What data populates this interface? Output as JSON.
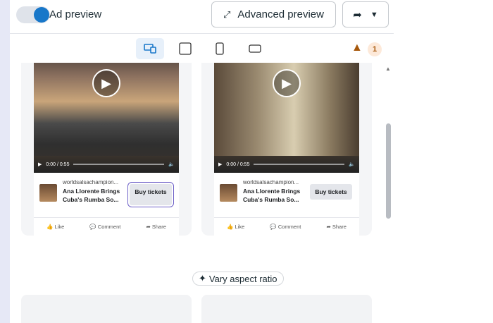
{
  "toggle": {
    "label": "Ad preview",
    "on": true
  },
  "toolbar": {
    "advanced_label": "Advanced preview"
  },
  "warnings": {
    "count": "1"
  },
  "cards": [
    {
      "time": "0:00 / 0:55",
      "domain": "worldsalsachampion...",
      "title": "Ana Llorente Brings Cuba's Rumba So...",
      "cta": "Buy tickets",
      "like": "Like",
      "comment": "Comment",
      "share": "Share"
    },
    {
      "time": "0:00 / 0:55",
      "domain": "worldsalsachampion...",
      "title": "Ana Llorente Brings Cuba's Rumba So...",
      "cta": "Buy tickets",
      "like": "Like",
      "comment": "Comment",
      "share": "Share"
    }
  ],
  "vary_label": "Vary aspect ratio"
}
